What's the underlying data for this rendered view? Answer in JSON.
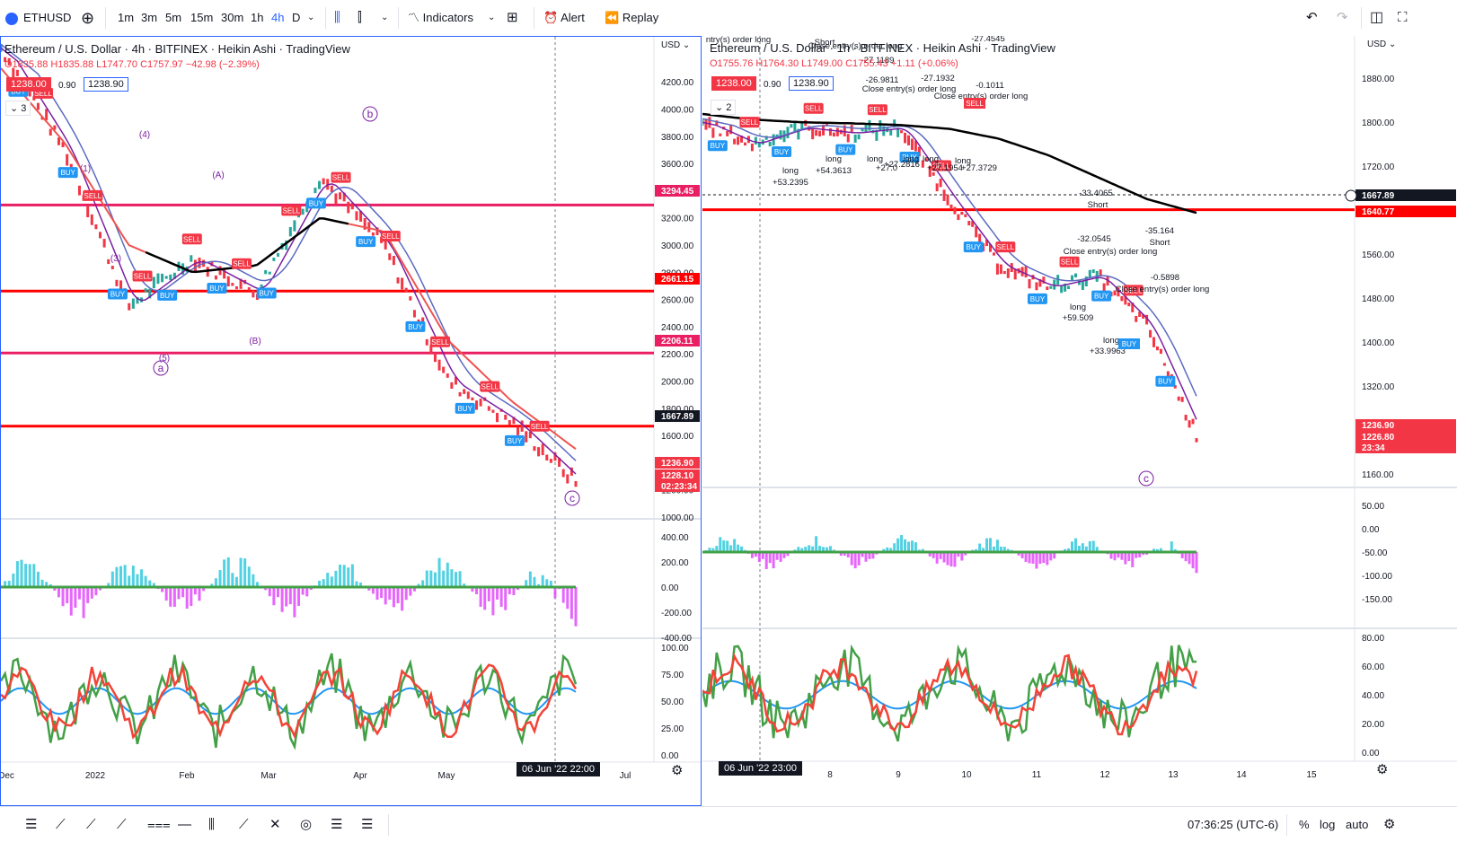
{
  "toolbar": {
    "symbol": "ETHUSD",
    "intervals": [
      "1m",
      "3m",
      "5m",
      "15m",
      "30m",
      "1h",
      "4h",
      "D"
    ],
    "active_interval": "4h",
    "indicators_label": "Indicators",
    "alert_label": "Alert",
    "replay_label": "Replay",
    "icons": [
      "add-symbol-icon",
      "chevron-down-icon",
      "bar-style-icon",
      "candle-style-icon",
      "indicators-icon",
      "templates-icon",
      "alert-icon",
      "replay-icon",
      "undo-icon",
      "redo-icon",
      "layout-icon",
      "fullscreen-icon"
    ]
  },
  "left": {
    "title": "Ethereum / U.S. Dollar · 4h · BITFINEX · Heikin Ashi · TradingView",
    "ohlc": "O1835.88 H1835.88 L1747.70 C1757.97 −42.98 (−2.39%)",
    "bid": "1238.00",
    "spread": "0.90",
    "ask": "1238.90",
    "layers": "3",
    "currency": "USD",
    "price_ticks": [
      "4200.00",
      "4000.00",
      "3800.00",
      "3600.00",
      "3400.00",
      "3200.00",
      "3000.00",
      "2800.00",
      "2600.00",
      "2400.00",
      "2200.00",
      "2000.00",
      "1800.00",
      "1600.00",
      "1400.00",
      "1200.00",
      "1000.00"
    ],
    "macd_ticks": [
      "400.00",
      "200.00",
      "0.00",
      "-200.00",
      "-400.00"
    ],
    "osc_ticks": [
      "100.00",
      "75.00",
      "50.00",
      "25.00",
      "0.00"
    ],
    "price_labels": [
      {
        "text": "3294.45",
        "color": "#e91e63"
      },
      {
        "text": "2661.15",
        "color": "#ff0000"
      },
      {
        "text": "2206.11",
        "color": "#e91e63"
      },
      {
        "text": "1667.89",
        "color": "#131722"
      },
      {
        "text": "1236.90",
        "color": "#f23645"
      },
      {
        "text": "1228.10",
        "color": "#f23645"
      },
      {
        "text": "02:23:34",
        "color": "#f23645"
      }
    ],
    "time_labels": [
      "Dec",
      "2022",
      "Feb",
      "Mar",
      "Apr",
      "May",
      "Jul"
    ],
    "crosshair_time": "06 Jun '22  22:00",
    "wave_labels": [
      "(1)",
      "(3)",
      "(4)",
      "(5)",
      "a",
      "(A)",
      "(B)",
      "b",
      "c"
    ],
    "signals": [
      "BUY",
      "SELL"
    ]
  },
  "right": {
    "title": "Ethereum / U.S. Dollar · 1h · BITFINEX · Heikin Ashi · TradingView",
    "ohlc": "O1755.76 H1764.30 L1749.00 C1755.43 +1.11 (+0.06%)",
    "bid": "1238.00",
    "spread": "0.90",
    "ask": "1238.90",
    "layers": "2",
    "currency": "USD",
    "price_ticks": [
      "1880.00",
      "1800.00",
      "1720.00",
      "1640.00",
      "1560.00",
      "1480.00",
      "1400.00",
      "1320.00",
      "1240.00",
      "1160.00"
    ],
    "macd_ticks": [
      "50.00",
      "0.00",
      "-50.00",
      "-100.00",
      "-150.00"
    ],
    "osc_ticks": [
      "80.00",
      "60.00",
      "40.00",
      "20.00",
      "0.00"
    ],
    "price_labels": [
      {
        "text": "1667.89",
        "color": "#131722"
      },
      {
        "text": "1640.77",
        "color": "#ff0000"
      },
      {
        "text": "1236.90",
        "color": "#f23645"
      },
      {
        "text": "1226.80",
        "color": "#f23645"
      },
      {
        "text": "23:34",
        "color": "#f23645"
      }
    ],
    "time_labels": [
      "8",
      "9",
      "10",
      "11",
      "12",
      "13",
      "14",
      "15"
    ],
    "crosshair_time": "06 Jun '22  23:00",
    "annotations": [
      "ntry(s) order long",
      "Short",
      "Close entry(s) order long",
      "-27.1189",
      "-26.9811",
      "Close entry(s) order long",
      "-27.1932",
      "-0.1011",
      "Close entry(s) order long",
      "-27.4545",
      "long",
      "+53.2395",
      "long",
      "+54.3613",
      "long",
      "+27.0",
      "long",
      "+27.2816",
      "long",
      "+27.1954",
      "long",
      "+27.3729",
      "-33.4065",
      "Short",
      "-35.164",
      "Short",
      "-32.0545",
      "Close entry(s) order long",
      "-0.5898",
      "Close entry(s) order long",
      "long",
      "+59.509",
      "long",
      "+33.9963",
      "c",
      "BUY",
      "SELL"
    ]
  },
  "bottom": {
    "time": "07:36:25 (UTC-6)",
    "percent_label": "%",
    "log_label": "log",
    "auto_label": "auto",
    "tools": [
      "bars-icon",
      "line-tool-icon",
      "pattern-icon",
      "trendline-icon",
      "fib-icon",
      "horizontal-line-icon",
      "sliders-icon",
      "ray-icon",
      "xabcd-icon",
      "spiral-icon",
      "lines-icon",
      "settings-list-icon"
    ]
  },
  "chart_data": [
    {
      "type": "line",
      "title": "Ethereum / U.S. Dollar · 4h · BITFINEX · Heikin Ashi · TradingView",
      "x": [
        "Dec",
        "2022",
        "Feb",
        "Mar",
        "Apr",
        "May",
        "06 Jun '22",
        "Jul"
      ],
      "ylim": [
        1000,
        4300
      ],
      "series": [
        {
          "values": [
            4450,
            3700,
            2550,
            2900,
            2650,
            3500,
            3000,
            2000,
            1700,
            1260
          ]
        },
        {
          "values": [
            4300,
            3750,
            3000,
            2800,
            2850,
            3200,
            3100,
            2300,
            1850,
            1500
          ]
        }
      ],
      "hlines": [
        3294.45,
        2661.15,
        2206.11,
        1667.89
      ]
    },
    {
      "type": "line",
      "title": "Ethereum / U.S. Dollar · 1h · BITFINEX · Heikin Ashi · TradingView",
      "x": [
        "06 Jun '22",
        "8",
        "9",
        "10",
        "11",
        "12",
        "13",
        "14",
        "15"
      ],
      "ylim": [
        1140,
        1900
      ],
      "series": [
        {
          "values": [
            1800,
            1760,
            1790,
            1780,
            1790,
            1660,
            1540,
            1500,
            1520,
            1430,
            1230
          ]
        },
        {
          "values": [
            1815,
            1805,
            1800,
            1798,
            1795,
            1788,
            1770,
            1740,
            1700,
            1660,
            1635
          ]
        }
      ],
      "hlines": [
        1667.89,
        1640.77
      ]
    }
  ]
}
